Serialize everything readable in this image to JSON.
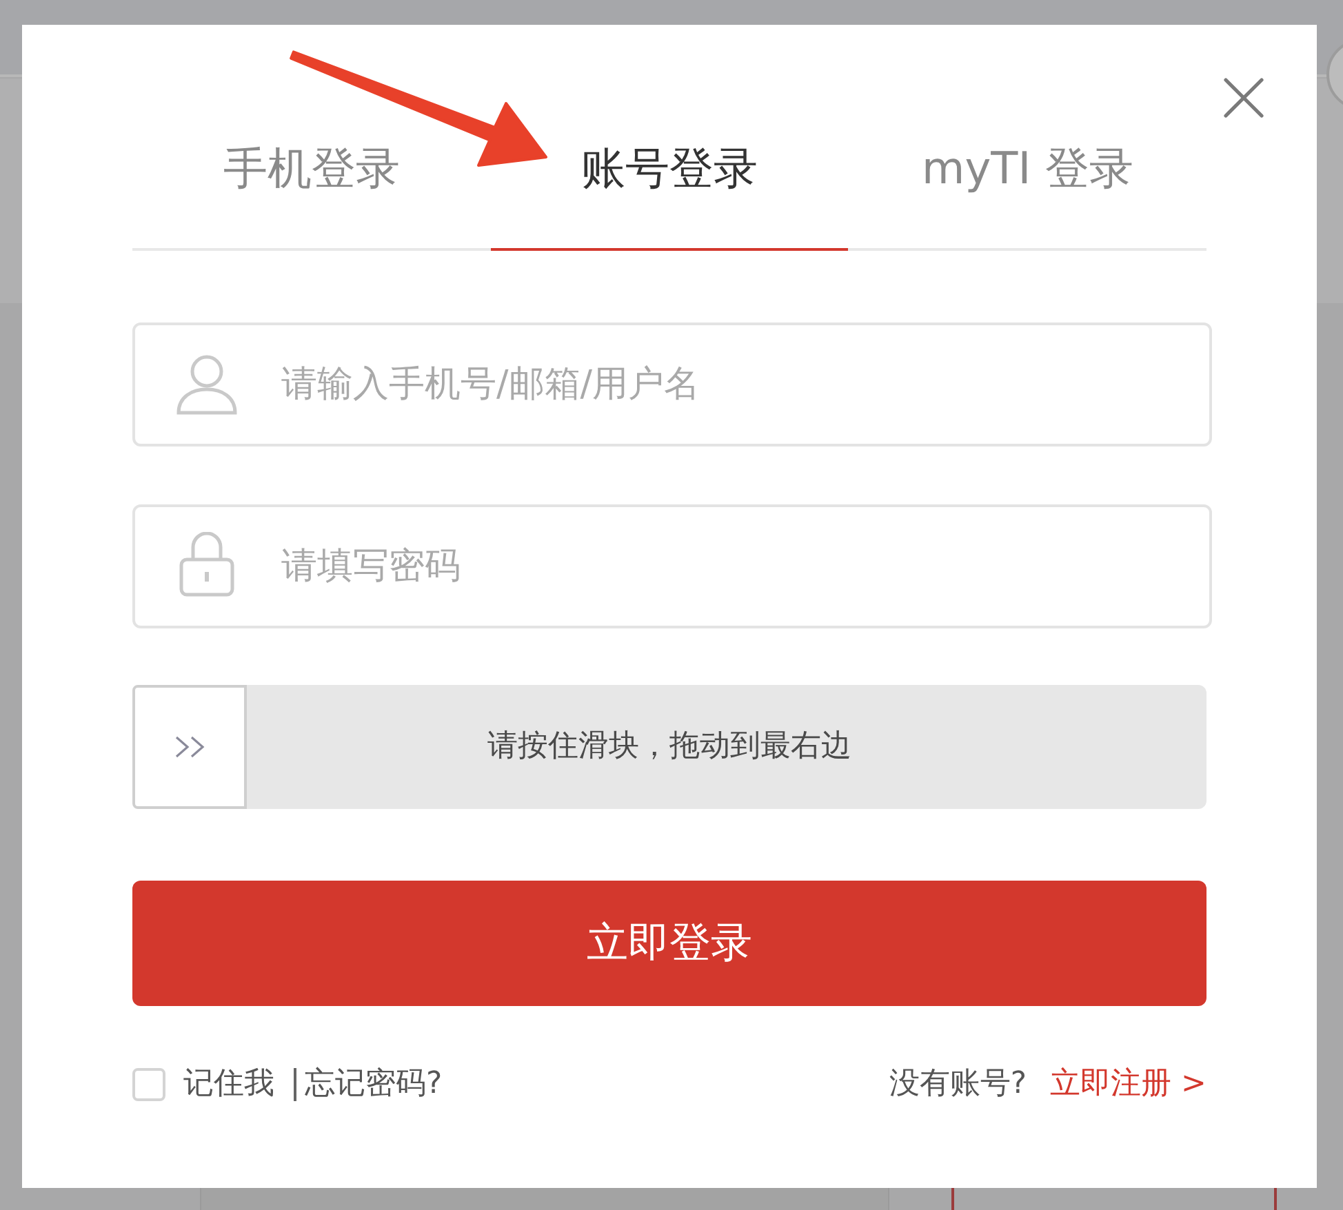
{
  "tabs": [
    {
      "label": "手机登录",
      "selected": false
    },
    {
      "label": "账号登录",
      "selected": true
    },
    {
      "label": "myTI 登录",
      "selected": false
    }
  ],
  "fields": [
    {
      "kind": "user",
      "placeholder": "请输入手机号/邮箱/用户名"
    },
    {
      "kind": "password",
      "placeholder": "请填写密码"
    }
  ],
  "slider_captcha": {
    "label": "请按住滑块，拖动到最右边",
    "level": 0
  },
  "login_button": "立即登录",
  "remember_me": {
    "label": "记住我",
    "checked": false
  },
  "forgot_password": "忘记密码?",
  "register_prompt": "没有账号?",
  "register_link": "立即注册 >"
}
